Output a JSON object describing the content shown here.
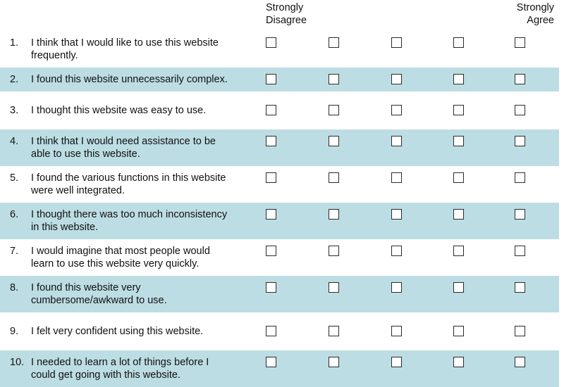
{
  "scale": {
    "low_label": "Strongly\nDisagree",
    "high_label": "Strongly\nAgree",
    "points": 5,
    "option_values": [
      "1",
      "2",
      "3",
      "4",
      "5"
    ]
  },
  "colors": {
    "row_shading": "#bcdde3",
    "row_plain": "#ffffff",
    "text": "#111111",
    "checkbox_border": "#2b2b2b",
    "checkbox_fill": "#ffffff"
  },
  "items": [
    {
      "number": "1.",
      "statement": "I think that I would like to use this website\nfrequently.",
      "shaded": false,
      "lines": 2
    },
    {
      "number": "2.",
      "statement": "I found this website unnecessarily complex.",
      "shaded": true,
      "lines": 1
    },
    {
      "number": "3.",
      "statement": "I thought this website was easy to use.",
      "shaded": false,
      "lines": 1
    },
    {
      "number": "4.",
      "statement": "I think that I would need assistance to be\nable to use this website.",
      "shaded": true,
      "lines": 2
    },
    {
      "number": "5.",
      "statement": "I found the various functions in this website\nwere well integrated.",
      "shaded": false,
      "lines": 2
    },
    {
      "number": "6.",
      "statement": "I thought there was too much inconsistency\nin this website.",
      "shaded": true,
      "lines": 2
    },
    {
      "number": "7.",
      "statement": "I would imagine that most people would\nlearn to use this website very quickly.",
      "shaded": false,
      "lines": 2
    },
    {
      "number": "8.",
      "statement": "I found this website very\ncumbersome/awkward to use.",
      "shaded": true,
      "lines": 2
    },
    {
      "number": "9.",
      "statement": "I felt very confident using this website.",
      "shaded": false,
      "lines": 1
    },
    {
      "number": "10.",
      "statement": "I needed to learn a lot of things before I\ncould get going with this website.",
      "shaded": true,
      "lines": 2
    }
  ]
}
